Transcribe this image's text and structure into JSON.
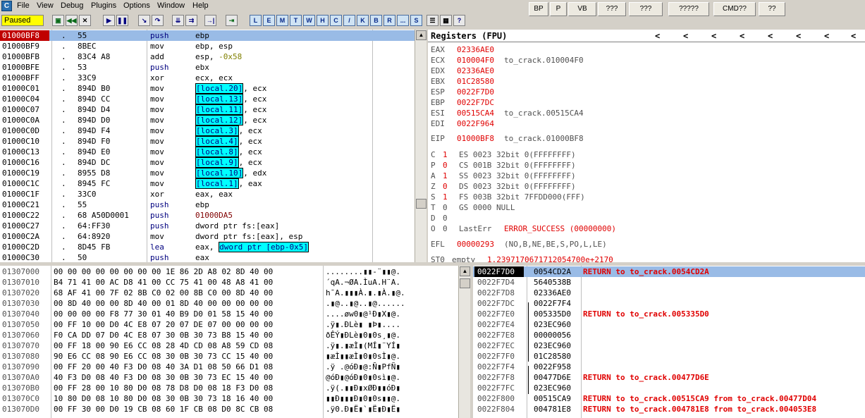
{
  "menu": [
    "File",
    "View",
    "Debug",
    "Plugins",
    "Options",
    "Window",
    "Help"
  ],
  "right_buttons": [
    "BP",
    "P",
    "VB",
    "???",
    "???",
    "?????",
    "CMD??",
    "??"
  ],
  "status": "Paused",
  "toolbar_letters": [
    "L",
    "E",
    "M",
    "T",
    "W",
    "H",
    "C",
    "/",
    "K",
    "B",
    "R",
    "...",
    "S"
  ],
  "cpu": [
    {
      "addr": "01000BF8",
      "dot": ".",
      "hex": "55",
      "mn": "push",
      "ops": "ebp",
      "sel": true
    },
    {
      "addr": "01000BF9",
      "dot": ".",
      "hex": "8BEC",
      "mn": "mov",
      "ops": "ebp, esp"
    },
    {
      "addr": "01000BFB",
      "dot": ".",
      "hex": "83C4 A8",
      "mn": "add",
      "ops": "esp, ",
      "num": "-0x58"
    },
    {
      "addr": "01000BFE",
      "dot": ".",
      "hex": "53",
      "mn": "push",
      "ops": "ebx"
    },
    {
      "addr": "01000BFF",
      "dot": ".",
      "hex": "33C9",
      "mn": "xor",
      "ops": "ecx, ecx"
    },
    {
      "addr": "01000C01",
      "dot": ".",
      "hex": "894D B0",
      "mn": "mov",
      "hl": "[local.20]",
      "ops": ", ecx"
    },
    {
      "addr": "01000C04",
      "dot": ".",
      "hex": "894D CC",
      "mn": "mov",
      "hl": "[local.13]",
      "ops": ", ecx"
    },
    {
      "addr": "01000C07",
      "dot": ".",
      "hex": "894D D4",
      "mn": "mov",
      "hl": "[local.11]",
      "ops": ", ecx"
    },
    {
      "addr": "01000C0A",
      "dot": ".",
      "hex": "894D D0",
      "mn": "mov",
      "hl": "[local.12]",
      "ops": ", ecx"
    },
    {
      "addr": "01000C0D",
      "dot": ".",
      "hex": "894D F4",
      "mn": "mov",
      "hl": "[local.3]",
      "ops": ", ecx"
    },
    {
      "addr": "01000C10",
      "dot": ".",
      "hex": "894D F0",
      "mn": "mov",
      "hl": "[local.4]",
      "ops": ", ecx"
    },
    {
      "addr": "01000C13",
      "dot": ".",
      "hex": "894D E0",
      "mn": "mov",
      "hl": "[local.8]",
      "ops": ", ecx"
    },
    {
      "addr": "01000C16",
      "dot": ".",
      "hex": "894D DC",
      "mn": "mov",
      "hl": "[local.9]",
      "ops": ", ecx"
    },
    {
      "addr": "01000C19",
      "dot": ".",
      "hex": "8955 D8",
      "mn": "mov",
      "hl": "[local.10]",
      "ops": ", edx"
    },
    {
      "addr": "01000C1C",
      "dot": ".",
      "hex": "8945 FC",
      "mn": "mov",
      "hl": "[local.1]",
      "ops": ", eax"
    },
    {
      "addr": "01000C1F",
      "dot": ".",
      "hex": "33C0",
      "mn": "xor",
      "ops": "eax, eax"
    },
    {
      "addr": "01000C21",
      "dot": ".",
      "hex": "55",
      "mn": "push",
      "ops": "ebp"
    },
    {
      "addr": "01000C22",
      "dot": ".",
      "hex": "68 A50D0001",
      "mn": "push",
      "ops": "",
      "num2": "01000DA5"
    },
    {
      "addr": "01000C27",
      "dot": ".",
      "hex": "64:FF30",
      "mn": "push",
      "ops": "dword ptr fs:[eax]"
    },
    {
      "addr": "01000C2A",
      "dot": ".",
      "hex": "64:8920",
      "mn": "mov",
      "ops": "dword ptr fs:[eax], esp"
    },
    {
      "addr": "01000C2D",
      "dot": ".",
      "hex": "8D45 FB",
      "mn": "lea",
      "ops": "eax, ",
      "hl2": "dword ptr [ebp-0x5]"
    },
    {
      "addr": "01000C30",
      "dot": ".",
      "hex": "50",
      "mn": "push",
      "ops": "eax"
    }
  ],
  "registers": {
    "title": "Registers (FPU)",
    "gp": [
      {
        "name": "EAX",
        "val": "02336AE0",
        "com": ""
      },
      {
        "name": "ECX",
        "val": "010004F0",
        "com": "to_crack.010004F0"
      },
      {
        "name": "EDX",
        "val": "02336AE0",
        "com": ""
      },
      {
        "name": "EBX",
        "val": "01C28580",
        "com": ""
      },
      {
        "name": "ESP",
        "val": "0022F7D0",
        "com": ""
      },
      {
        "name": "EBP",
        "val": "0022F7DC",
        "com": ""
      },
      {
        "name": "ESI",
        "val": "00515CA4",
        "com": "to_crack.00515CA4"
      },
      {
        "name": "EDI",
        "val": "0022F964",
        "com": ""
      }
    ],
    "eip": {
      "name": "EIP",
      "val": "01000BF8",
      "com": "to_crack.01000BF8"
    },
    "flags": [
      {
        "f": "C",
        "v": "1",
        "seg": "ES 0023 32bit 0(FFFFFFFF)",
        "red": true
      },
      {
        "f": "P",
        "v": "0",
        "seg": "CS 001B 32bit 0(FFFFFFFF)",
        "red": true
      },
      {
        "f": "A",
        "v": "1",
        "seg": "SS 0023 32bit 0(FFFFFFFF)",
        "red": true
      },
      {
        "f": "Z",
        "v": "0",
        "seg": "DS 0023 32bit 0(FFFFFFFF)",
        "red": true
      },
      {
        "f": "S",
        "v": "1",
        "seg": "FS 003B 32bit 7FFDD000(FFF)",
        "red": true
      },
      {
        "f": "T",
        "v": "0",
        "seg": "GS 0000 NULL",
        "red": false
      },
      {
        "f": "D",
        "v": "0",
        "seg": "",
        "red": false
      },
      {
        "f": "O",
        "v": "0",
        "seg": "LastErr",
        "red": false
      }
    ],
    "lasterr": "ERROR_SUCCESS (00000000)",
    "efl": {
      "name": "EFL",
      "val": "00000293",
      "com": "(NO,B,NE,BE,S,PO,L,LE)"
    },
    "st0": {
      "name": "ST0",
      "tag": "empty",
      "val": "1.2397170671712054700e+2170"
    }
  },
  "dump": [
    {
      "addr": "01307000",
      "hex": "00 00 00 00 00 00 00 00 1E 86 2D A8 02 8D 40 00",
      "asc": "........▮▮-¨▮▮@."
    },
    {
      "addr": "01307010",
      "hex": "B4 71 41 00 AC D8 41 00 CC 75 41 00 48 A8 41 00",
      "asc": "´qA.¬ØA.ÌuA.H¨A."
    },
    {
      "addr": "01307020",
      "hex": "68 AF 41 00 7F 02 8B C0 02 00 8B C0 00 8D 40 00",
      "asc": "h¯A.▮▮▮À.▮.▮À.▮@."
    },
    {
      "addr": "01307030",
      "hex": "00 8D 40 00 00 8D 40 00 01 8D 40 00 00 00 00 00",
      "asc": ".▮@..▮@..▮@......"
    },
    {
      "addr": "01307040",
      "hex": "00 00 00 00 F8 77 30 01 40 B9 D0 01 58 15 40 00",
      "asc": "....øw0▮@¹Ð▮X▮@."
    },
    {
      "addr": "01307050",
      "hex": "00 FF 10 00 D0 4C E8 07 20 07 DE 07 00 00 00 00",
      "asc": ".ÿ▮.ÐLè▮ ▮Þ▮...."
    },
    {
      "addr": "01307060",
      "hex": "F0 CA DD 07 D0 4C E8 07 30 0B 30 73 B8 15 40 00",
      "asc": "ðÊÝ▮ÐLè▮0▮0s¸▮@."
    },
    {
      "addr": "01307070",
      "hex": "00 FF 18 00 90 E6 CC 08 28 4D CD 08 A8 59 CD 08",
      "asc": ".ÿ▮.▮æÌ▮(MÍ▮¨YÍ▮"
    },
    {
      "addr": "01307080",
      "hex": "90 E6 CC 08 90 E6 CC 08 30 0B 30 73 CC 15 40 00",
      "asc": "▮æÌ▮▮æÌ▮0▮0sÌ▮@."
    },
    {
      "addr": "01307090",
      "hex": "00 FF 20 00 40 F3 D0 08 40 3A D1 08 50 66 D1 08",
      "asc": ".ÿ .@óÐ▮@:Ñ▮PfÑ▮"
    },
    {
      "addr": "013070A0",
      "hex": "40 F3 D0 08 40 F3 D0 08 30 0B 30 73 EC 15 40 00",
      "asc": "@óÐ▮@óÐ▮0▮0sì▮@."
    },
    {
      "addr": "013070B0",
      "hex": "00 FF 28 00 10 80 D0 08 78 D8 D0 08 18 F3 D0 08",
      "asc": ".ÿ(.▮▮Ð▮xØÐ▮▮óÐ▮"
    },
    {
      "addr": "013070C0",
      "hex": "10 80 D0 08 10 80 D0 08 30 0B 30 73 18 16 40 00",
      "asc": "▮▮Ð▮▮▮Ð▮0▮0s▮▮@."
    },
    {
      "addr": "013070D0",
      "hex": "00 FF 30 00 D0 19 CB 08 60 1F CB 08 D0 8C CB 08",
      "asc": ".ÿ0.Ð▮Ë▮`▮Ë▮Ð▮Ë▮"
    }
  ],
  "stack": [
    {
      "addr": "0022F7D0",
      "val": "0054CD2A",
      "com": "RETURN to to_crack.0054CD2A",
      "sel": true
    },
    {
      "addr": "0022F7D4",
      "val": "5640538B",
      "com": ""
    },
    {
      "addr": "0022F7D8",
      "val": "02336AE0",
      "com": ""
    },
    {
      "addr": "0022F7DC",
      "val": "0022F7F4",
      "com": ""
    },
    {
      "addr": "0022F7E0",
      "val": "005335D0",
      "com": "RETURN to to_crack.005335D0"
    },
    {
      "addr": "0022F7E4",
      "val": "023EC960",
      "com": ""
    },
    {
      "addr": "0022F7E8",
      "val": "00000056",
      "com": ""
    },
    {
      "addr": "0022F7EC",
      "val": "023EC960",
      "com": ""
    },
    {
      "addr": "0022F7F0",
      "val": "01C28580",
      "com": ""
    },
    {
      "addr": "0022F7F4",
      "val": "0022F958",
      "com": ""
    },
    {
      "addr": "0022F7F8",
      "val": "00477D6E",
      "com": "RETURN to to_crack.00477D6E"
    },
    {
      "addr": "0022F7FC",
      "val": "023EC960",
      "com": ""
    },
    {
      "addr": "0022F800",
      "val": "00515CA9",
      "com": "RETURN to to_crack.00515CA9 from to_crack.00477D04"
    },
    {
      "addr": "0022F804",
      "val": "004781E8",
      "com": "RETURN to to_crack.004781E8 from to_crack.004053E8"
    }
  ]
}
